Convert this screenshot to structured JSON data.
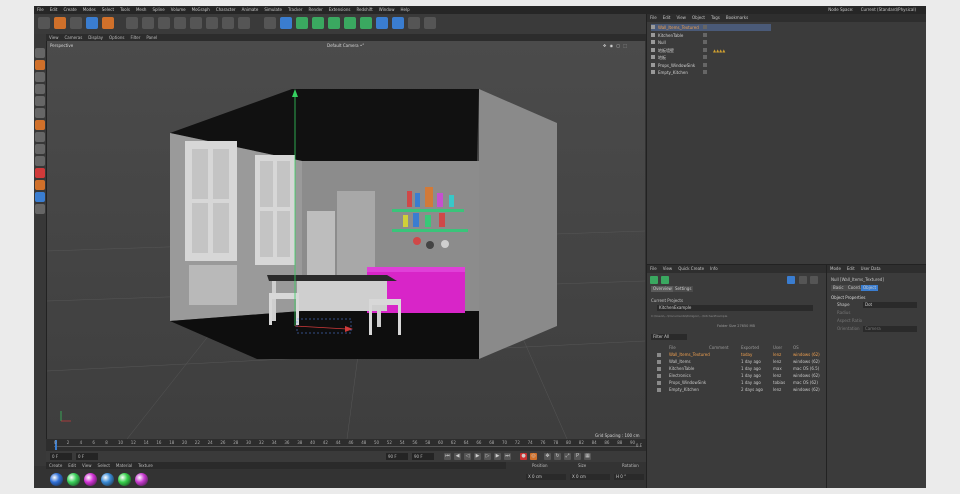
{
  "menubar": {
    "items": [
      "File",
      "Edit",
      "Create",
      "Modes",
      "Select",
      "Tools",
      "Mesh",
      "Spline",
      "Volume",
      "MoGraph",
      "Character",
      "Animate",
      "Simulate",
      "Tracker",
      "Render",
      "Extensions",
      "Redshift",
      "Window",
      "Help"
    ],
    "node_space": "Node Space:",
    "node_space_value": "Current (Standard/Physical)"
  },
  "viewport": {
    "menu": [
      "View",
      "Cameras",
      "Display",
      "Options",
      "Filter",
      "Panel"
    ],
    "label": "Perspective",
    "camera": "Default Camera •°",
    "grid_spacing": "Grid Spacing : 100 cm"
  },
  "timeline": {
    "ticks": [
      "0",
      "2",
      "4",
      "6",
      "8",
      "10",
      "12",
      "14",
      "16",
      "18",
      "20",
      "22",
      "24",
      "26",
      "28",
      "30",
      "32",
      "34",
      "36",
      "38",
      "40",
      "42",
      "44",
      "46",
      "48",
      "50",
      "52",
      "54",
      "56",
      "58",
      "60",
      "62",
      "64",
      "66",
      "68",
      "70",
      "72",
      "74",
      "76",
      "78",
      "80",
      "82",
      "84",
      "86",
      "88",
      "90"
    ],
    "end_label": "0 F",
    "start_field": "0 F",
    "start_field2": "0 F",
    "end_field": "90 F",
    "end_field2": "90 F"
  },
  "material_bar": {
    "menu": [
      "Create",
      "Edit",
      "View",
      "Select",
      "Material",
      "Texture"
    ],
    "colors": [
      "#2f6fd6",
      "#3ad15a",
      "#d232d6",
      "#3a8bd6",
      "#37d04b",
      "#c83ad0"
    ]
  },
  "coordinates": {
    "position": "Position",
    "size": "Size",
    "rotation": "Rotation",
    "x_pos": "X 0 cm",
    "x_size": "X 0 cm",
    "h_rot": "H 0 °"
  },
  "object_manager": {
    "menu": [
      "File",
      "Edit",
      "View",
      "Object",
      "Tags",
      "Bookmarks"
    ],
    "objects": [
      "Wall_Items_Textured",
      "KitchenTable",
      "Null",
      "地板墙壁",
      "地板",
      "Props_WindowSink",
      "Empty_Kitchen"
    ]
  },
  "asset_browser": {
    "menu": [
      "File",
      "View",
      "Quick Create",
      "Info"
    ],
    "tabs": [
      "Overview",
      "Settings"
    ],
    "current_projects": "Current Projects",
    "project_name": "KitchenExample",
    "path": "C:\\Users\\...\\Documents\\Poliigon\\...\\KitchenExample",
    "folder_size": "Folder Size 27650 MB",
    "filter": "Filter All",
    "columns": [
      "File",
      "Comment",
      "Exported",
      "User",
      "OS"
    ],
    "rows": [
      {
        "file": "Wall_Items_Textured",
        "exported": "today",
        "user": "lenz",
        "os": "windows (62)"
      },
      {
        "file": "Wall_Items",
        "exported": "1 day ago",
        "user": "lenz",
        "os": "windows (62)"
      },
      {
        "file": "KitchenTable",
        "exported": "1 day ago",
        "user": "max",
        "os": "mac OS (6.5)"
      },
      {
        "file": "Electronics",
        "exported": "1 day ago",
        "user": "lenz",
        "os": "windows (62)"
      },
      {
        "file": "Props_WindowSink",
        "exported": "1 day ago",
        "user": "tobias",
        "os": "mac OS (62)"
      },
      {
        "file": "Empty_Kitchen",
        "exported": "2 days ago",
        "user": "lenz",
        "os": "windows (62)"
      }
    ]
  },
  "attribute_manager": {
    "menu": [
      "Mode",
      "Edit",
      "User Data"
    ],
    "object_name": "Null [Wall_Items_Textured]",
    "tabs": [
      "Basic",
      "Coord.",
      "Object"
    ],
    "section": "Object Properties",
    "props": [
      {
        "label": "Shape",
        "value": "Dot"
      },
      {
        "label": "Radius",
        "value": ""
      },
      {
        "label": "Aspect Ratio",
        "value": ""
      },
      {
        "label": "Orientation",
        "value": "Camera"
      }
    ]
  }
}
